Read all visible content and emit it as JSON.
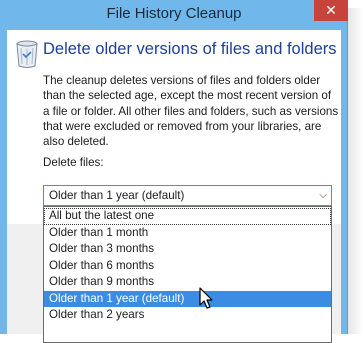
{
  "window": {
    "title": "File History Cleanup",
    "close_glyph": "✕"
  },
  "dialog": {
    "icon": "recycle-bin-icon",
    "heading": "Delete older versions of files and folders",
    "description": "The cleanup deletes versions of files and folders older than the selected age, except the most recent version of a file or folder. All other files and folders, such as versions that were excluded or removed from your libraries, are also deleted.",
    "delete_label": "Delete files:",
    "select_value": "Older than 1 year (default)",
    "options": [
      "All but the latest one",
      "Older than 1 month",
      "Older than 3 months",
      "Older than 6 months",
      "Older than 9 months",
      "Older than 1 year (default)",
      "Older than 2 years"
    ],
    "highlighted_option_index": 5
  },
  "colors": {
    "title_bar": "#70b8ec",
    "close_button": "#c7443c",
    "heading": "#1e3f9a",
    "selection": "#3a8de3"
  }
}
